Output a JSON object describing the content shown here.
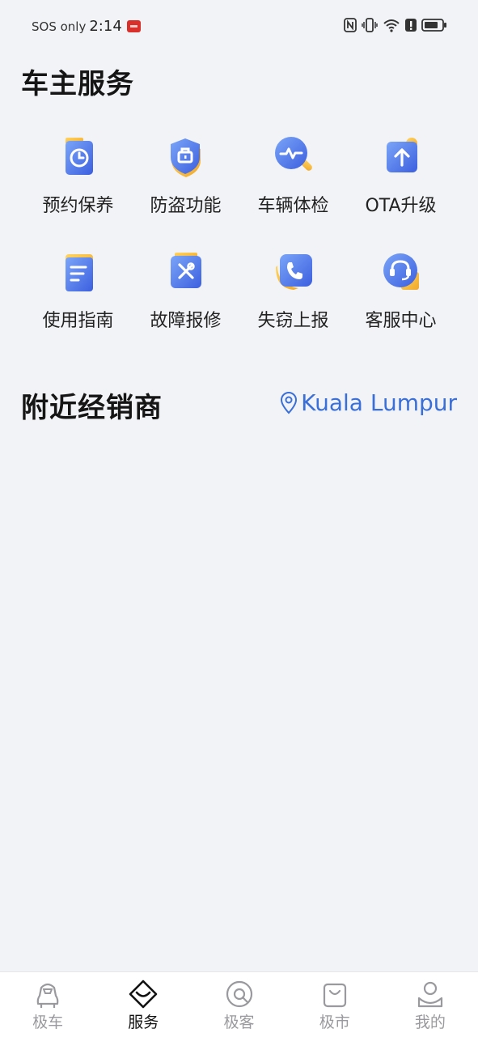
{
  "status_bar": {
    "carrier": "SOS only",
    "time": "2:14",
    "icons": [
      "nfc-icon",
      "vibrate-icon",
      "wifi-icon",
      "alert-icon",
      "battery-icon"
    ]
  },
  "service_section": {
    "title": "车主服务",
    "items": [
      {
        "label": "预约保养",
        "icon": "clock-icon"
      },
      {
        "label": "防盗功能",
        "icon": "shield-icon"
      },
      {
        "label": "车辆体检",
        "icon": "diagnostic-icon"
      },
      {
        "label": "OTA升级",
        "icon": "upgrade-icon"
      },
      {
        "label": "使用指南",
        "icon": "guide-icon"
      },
      {
        "label": "故障报修",
        "icon": "repair-icon"
      },
      {
        "label": "失窃上报",
        "icon": "phone-icon"
      },
      {
        "label": "客服中心",
        "icon": "headset-icon"
      }
    ]
  },
  "dealer_section": {
    "title": "附近经销商",
    "location": "Kuala Lumpur"
  },
  "bottom_nav": {
    "items": [
      {
        "label": "极车",
        "icon": "car-icon",
        "active": false
      },
      {
        "label": "服务",
        "icon": "service-icon",
        "active": true
      },
      {
        "label": "极客",
        "icon": "community-icon",
        "active": false
      },
      {
        "label": "极市",
        "icon": "shop-bag-icon",
        "active": false
      },
      {
        "label": "我的",
        "icon": "profile-icon",
        "active": false
      }
    ]
  },
  "colors": {
    "background": "#f2f3f6",
    "accent_blue": "#3a6fd8",
    "icon_gradient_start": "#6f9bf5",
    "icon_gradient_end": "#3e63e0",
    "icon_highlight": "#f5c24a"
  }
}
